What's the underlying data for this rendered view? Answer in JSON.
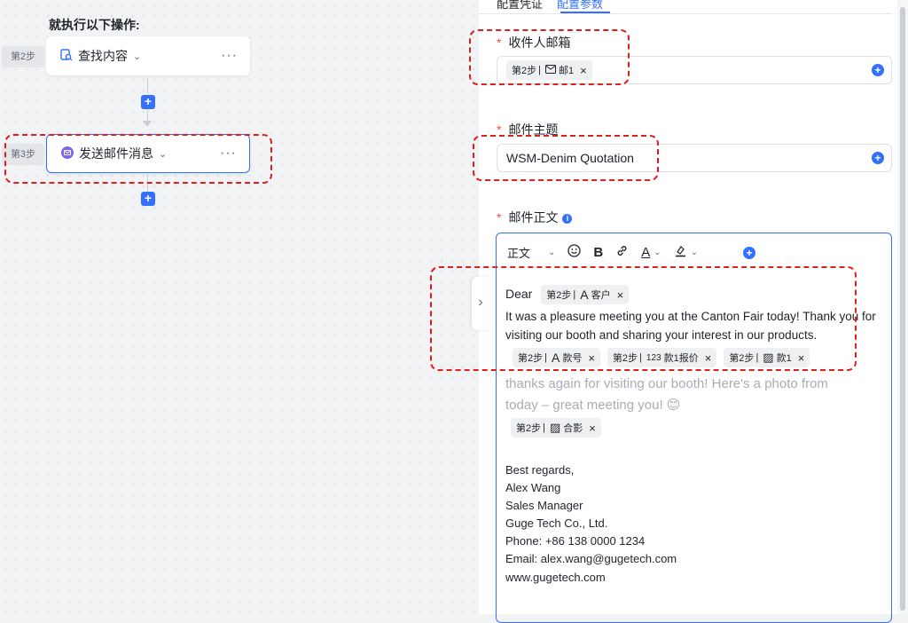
{
  "canvas": {
    "heading": "就执行以下操作:",
    "steps": [
      {
        "tag": "第2步",
        "label": "查找内容",
        "icon": "search-doc-icon"
      },
      {
        "tag": "第3步",
        "label": "发送邮件消息",
        "icon": "mail-icon"
      }
    ],
    "add_symbol": "+",
    "more_symbol": "···",
    "chevron": "⌄"
  },
  "panel": {
    "tabs": [
      "配置凭证",
      "配置参数"
    ],
    "active_tab": "配置参数",
    "recipient": {
      "label": "收件人邮箱",
      "chip": {
        "step": "第2步",
        "icon": "mail-outline-icon",
        "text": "邮1"
      }
    },
    "subject": {
      "label": "邮件主题",
      "value": "WSM-Denim Quotation"
    },
    "body": {
      "label": "邮件正文",
      "toolbar": {
        "style": "正文"
      },
      "greeting": "Dear",
      "chip_customer": {
        "step": "第2步",
        "text": "客户"
      },
      "line1": "It was a pleasure meeting you at the Canton Fair today! Thank you for",
      "line2": "visiting our booth and sharing your interest in our products.",
      "chips_row": [
        {
          "step": "第2步",
          "icon_text": "A",
          "text": "款号"
        },
        {
          "step": "第2步",
          "icon_text": "123",
          "text": "款1报价"
        },
        {
          "step": "第2步",
          "icon_text": "▨",
          "text": "款1"
        }
      ],
      "placeholder1": " thanks again for visiting our booth! Here's a photo from",
      "placeholder2": "today – great meeting you! 😊",
      "chip_photo": {
        "step": "第2步",
        "text": "合影"
      },
      "signature": [
        "Best regards,",
        "Alex Wang",
        "Sales Manager",
        "Guge Tech Co., Ltd.",
        "Phone: +86 138 0000 1234",
        "Email: alex.wang@gugetech.com",
        "www.gugetech.com"
      ]
    },
    "required_mark": "*"
  },
  "colors": {
    "accent": "#3370ff",
    "required": "#f54a45",
    "highlight": "#e01e1e"
  }
}
